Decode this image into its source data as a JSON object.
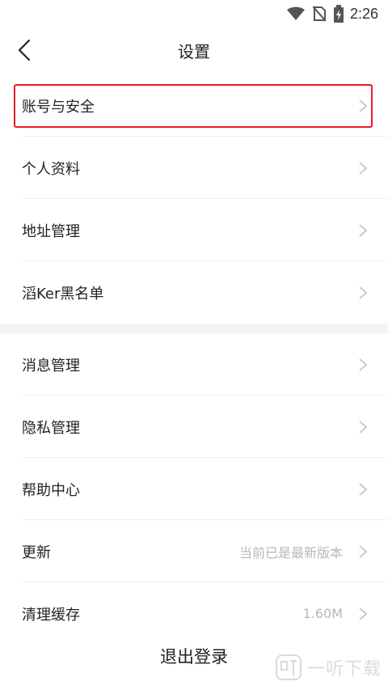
{
  "status_bar": {
    "time": "2:26",
    "icons": [
      "wifi-icon",
      "no-sim-icon",
      "battery-charging-icon"
    ]
  },
  "header": {
    "title": "设置",
    "back_icon": "chevron-left-icon"
  },
  "settings": {
    "group1": [
      {
        "label": "账号与安全",
        "value": ""
      },
      {
        "label": "个人资料",
        "value": ""
      },
      {
        "label": "地址管理",
        "value": ""
      },
      {
        "label": "滔Ker黑名单",
        "value": ""
      }
    ],
    "group2": [
      {
        "label": "消息管理",
        "value": ""
      },
      {
        "label": "隐私管理",
        "value": ""
      },
      {
        "label": "帮助中心",
        "value": ""
      },
      {
        "label": "更新",
        "value": "当前已是最新版本"
      },
      {
        "label": "清理缓存",
        "value": "1.60M"
      }
    ]
  },
  "logout_label": "退出登录",
  "watermark": {
    "text": "一听下载"
  },
  "colors": {
    "highlight_border": "#e51c23",
    "secondary_text": "#b8b8b8",
    "section_gap": "#f4f4f4"
  }
}
